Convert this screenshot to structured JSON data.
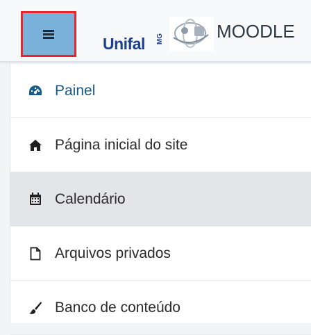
{
  "header": {
    "brand_logo_text": "Unifal",
    "brand_logo_sub": "MG",
    "brand_name": "MOODLE",
    "menu_toggle_icon": "hamburger-icon",
    "colors": {
      "toggle_bg": "#7ab1da",
      "toggle_border": "#e8262b",
      "brand_blue": "#1c3f8f"
    }
  },
  "nav": {
    "items": [
      {
        "label": "Painel",
        "icon": "dashboard-icon",
        "active": false
      },
      {
        "label": "Página inicial do site",
        "icon": "home-icon",
        "active": false
      },
      {
        "label": "Calendário",
        "icon": "calendar-icon",
        "active": true
      },
      {
        "label": "Arquivos privados",
        "icon": "file-icon",
        "active": false
      },
      {
        "label": "Banco de conteúdo",
        "icon": "paintbrush-icon",
        "active": false
      }
    ],
    "colors": {
      "link": "#155a8a",
      "active_bg": "#e3e6e9"
    }
  }
}
